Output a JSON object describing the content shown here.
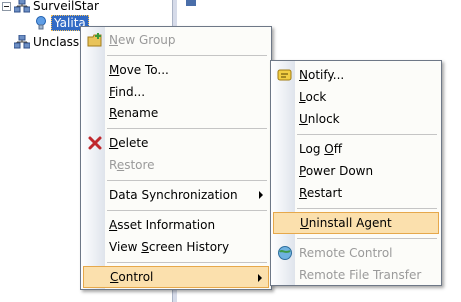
{
  "tree": {
    "root_label": "SurveilStar",
    "selected_label": "Yalita",
    "unclassified_label": "Unclass"
  },
  "main_menu": {
    "items": [
      {
        "id": "new-group",
        "pre": "",
        "u": "N",
        "post": "ew Group",
        "disabled": true,
        "icon": "new-group-icon"
      },
      {
        "id": "move-to",
        "pre": "",
        "u": "M",
        "post": "ove To...",
        "disabled": false
      },
      {
        "id": "find",
        "pre": "",
        "u": "F",
        "post": "ind...",
        "disabled": false
      },
      {
        "id": "rename",
        "pre": "",
        "u": "R",
        "post": "ename",
        "disabled": false
      },
      {
        "id": "delete",
        "pre": "",
        "u": "D",
        "post": "elete",
        "disabled": false,
        "icon": "delete-x-icon"
      },
      {
        "id": "restore",
        "pre": "R",
        "u": "e",
        "post": "store",
        "disabled": true
      },
      {
        "id": "data-sync",
        "pre": "Data Synchronization",
        "u": "",
        "post": "",
        "disabled": false,
        "submenu": true
      },
      {
        "id": "asset-info",
        "pre": "",
        "u": "A",
        "post": "sset Information",
        "disabled": false
      },
      {
        "id": "screen-history",
        "pre": "View ",
        "u": "S",
        "post": "creen History",
        "disabled": false
      },
      {
        "id": "control",
        "pre": "",
        "u": "C",
        "post": "ontrol",
        "disabled": false,
        "submenu": true,
        "highlighted": true
      }
    ]
  },
  "sub_menu": {
    "items": [
      {
        "id": "notify",
        "pre": "",
        "u": "N",
        "post": "otify...",
        "disabled": false,
        "icon": "notify-icon"
      },
      {
        "id": "lock",
        "pre": "",
        "u": "L",
        "post": "ock",
        "disabled": false
      },
      {
        "id": "unlock",
        "pre": "",
        "u": "U",
        "post": "nlock",
        "disabled": false
      },
      {
        "id": "log-off",
        "pre": "Log ",
        "u": "O",
        "post": "ff",
        "disabled": false
      },
      {
        "id": "power-down",
        "pre": "",
        "u": "P",
        "post": "ower Down",
        "disabled": false
      },
      {
        "id": "restart",
        "pre": "",
        "u": "R",
        "post": "estart",
        "disabled": false
      },
      {
        "id": "uninstall-agent",
        "pre": "",
        "u": "U",
        "post": "ninstall Agent",
        "disabled": false,
        "highlighted": true
      },
      {
        "id": "remote-control",
        "pre": "Remote Control",
        "u": "",
        "post": "",
        "disabled": true,
        "icon": "remote-control-icon"
      },
      {
        "id": "remote-file-transfer",
        "pre": "Remote File Transfer",
        "u": "",
        "post": "",
        "disabled": true
      }
    ]
  }
}
